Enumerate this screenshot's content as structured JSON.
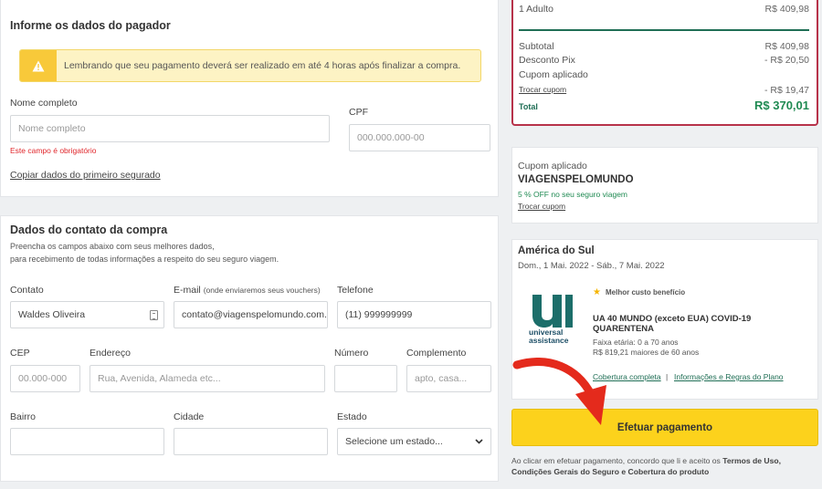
{
  "payer": {
    "title": "Informe os dados do pagador",
    "alert": "Lembrando que seu pagamento deverá ser realizado em até 4 horas após finalizar a compra.",
    "name_label": "Nome completo",
    "name_placeholder": "Nome completo",
    "name_error": "Este campo é obrigatório",
    "cpf_label": "CPF",
    "cpf_placeholder": "000.000.000-00",
    "copy_link": "Copiar dados do primeiro segurado"
  },
  "contact": {
    "title": "Dados do contato da compra",
    "desc_line1": "Preencha os campos abaixo com seus melhores dados,",
    "desc_line2": "para recebimento de todas informações a respeito do seu seguro viagem.",
    "contato_label": "Contato",
    "contato_value": "Waldes Oliveira",
    "email_label": "E-mail",
    "email_note": "(onde enviaremos seus vouchers)",
    "email_value": "contato@viagenspelomundo.com.",
    "telefone_label": "Telefone",
    "telefone_value": "(11) 999999999",
    "cep_label": "CEP",
    "cep_placeholder": "00.000-000",
    "endereco_label": "Endereço",
    "endereco_placeholder": "Rua, Avenida, Alameda etc...",
    "numero_label": "Número",
    "complemento_label": "Complemento",
    "complemento_placeholder": "apto, casa...",
    "bairro_label": "Bairro",
    "cidade_label": "Cidade",
    "estado_label": "Estado",
    "estado_value": "Selecione um estado..."
  },
  "summary": {
    "adult_label": "1 Adulto",
    "adult_value": "R$ 409,98",
    "subtotal_label": "Subtotal",
    "subtotal_value": "R$ 409,98",
    "pix_label": "Desconto Pix",
    "pix_value": "- R$ 20,50",
    "coupon_label": "Cupom aplicado",
    "change_coupon": "Trocar cupom",
    "coupon_value": "- R$ 19,47",
    "total_label": "Total",
    "total_value": "R$ 370,01"
  },
  "coupon": {
    "label": "Cupom aplicado",
    "code": "VIAGENSPELOMUNDO",
    "desc": "5 % OFF no seu seguro viagem",
    "change": "Trocar cupom"
  },
  "plan": {
    "region": "América do Sul",
    "dates": "Dom., 1 Mai. 2022 - Sáb., 7 Mai. 2022",
    "badge": "Melhor custo benefício",
    "logo_line1": "universal",
    "logo_line2": "assistance",
    "name": "UA 40 MUNDO (exceto EUA) COVID-19 QUARENTENA",
    "age": "Faixa etária: 0 a 70 anos",
    "senior": "R$ 819,21 maiores de 60 anos",
    "coverage_link": "Cobertura completa",
    "separator": "|",
    "rules_link": "Informações e Regras do Plano"
  },
  "pay_button": "Efetuar pagamento",
  "terms": {
    "prefix": "Ao clicar em efetuar pagamento, concordo que li e aceito os ",
    "bold": "Termos de Uso, Condições Gerais do Seguro e Cobertura do produto"
  },
  "colors": {
    "accent_yellow": "#fcd21c",
    "summary_border": "#b7324a",
    "total_green": "#1f8a52",
    "error_red": "#e0262b",
    "ua_teal": "#1c6e6a"
  }
}
